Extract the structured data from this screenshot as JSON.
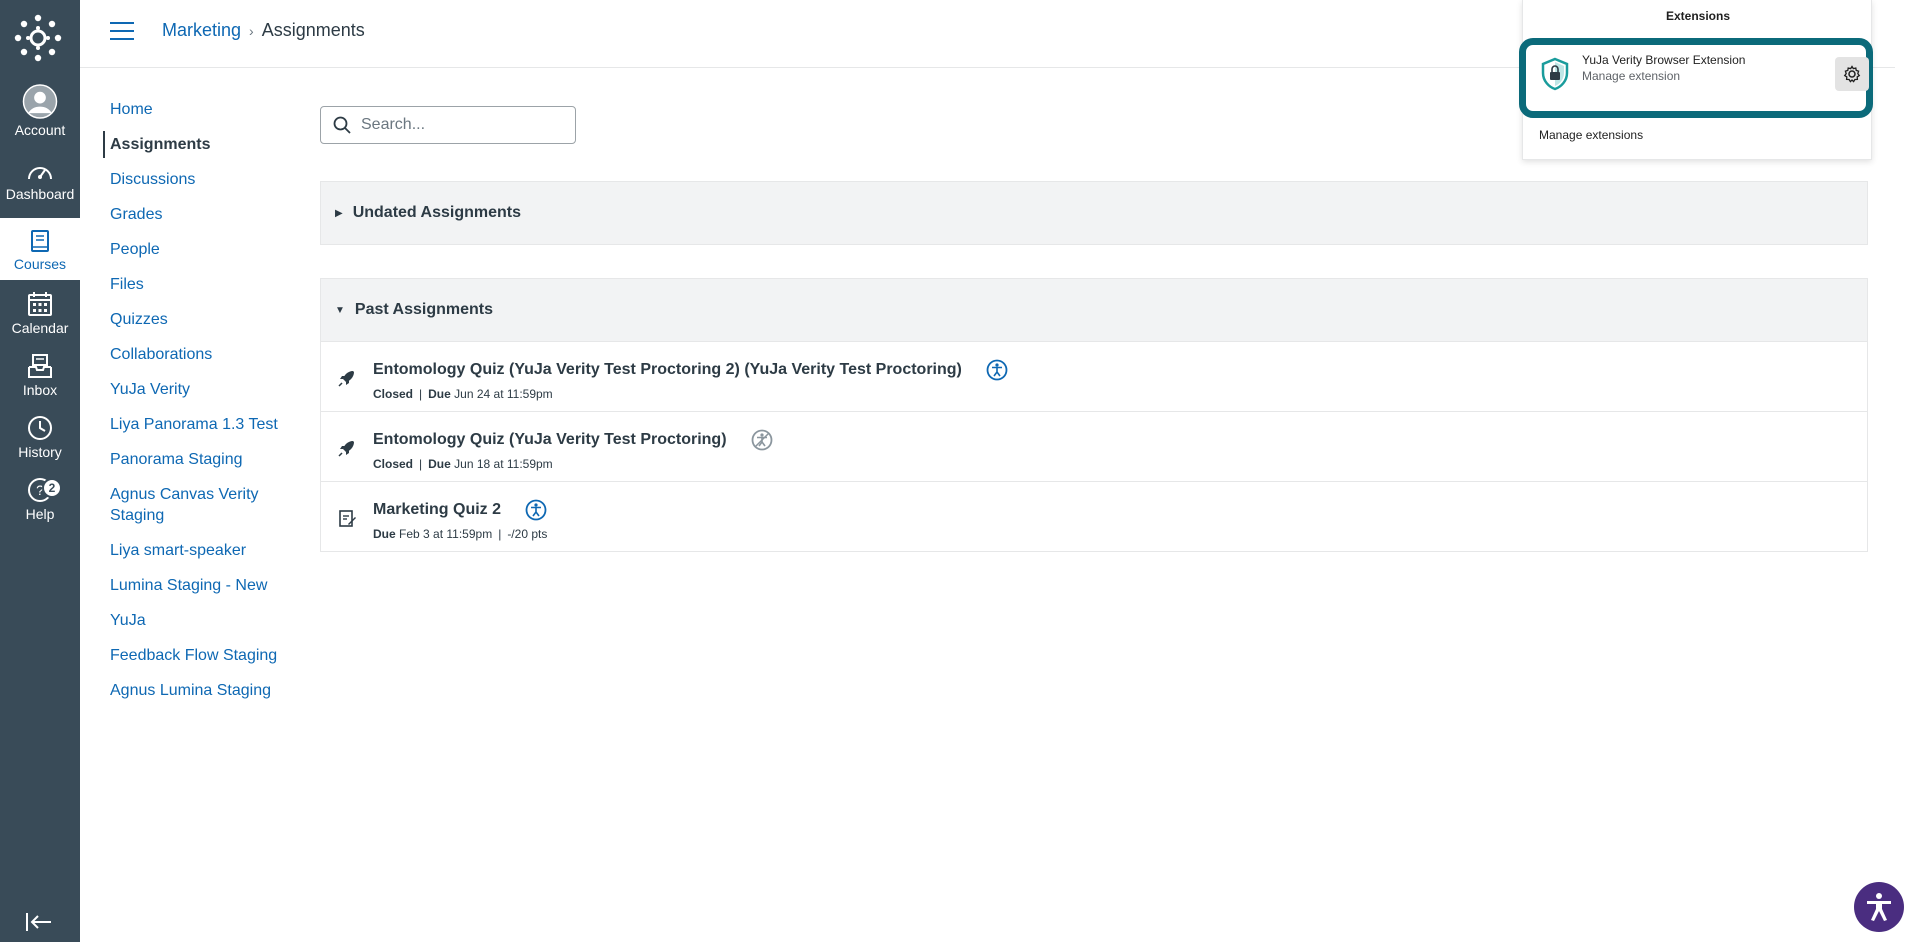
{
  "global_nav": {
    "items": [
      {
        "label": "Account",
        "icon": "account-icon"
      },
      {
        "label": "Dashboard",
        "icon": "dashboard-icon"
      },
      {
        "label": "Courses",
        "icon": "courses-icon"
      },
      {
        "label": "Calendar",
        "icon": "calendar-icon"
      },
      {
        "label": "Inbox",
        "icon": "inbox-icon"
      },
      {
        "label": "History",
        "icon": "history-icon"
      },
      {
        "label": "Help",
        "icon": "help-icon",
        "badge": "2"
      }
    ]
  },
  "breadcrumb": {
    "course": "Marketing",
    "current": "Assignments"
  },
  "course_nav": {
    "items": [
      "Home",
      "Assignments",
      "Discussions",
      "Grades",
      "People",
      "Files",
      "Quizzes",
      "Collaborations",
      "YuJa Verity",
      "Liya Panorama 1.3 Test",
      "Panorama Staging",
      "Agnus Canvas Verity Staging",
      "Liya smart-speaker",
      "Lumina Staging - New",
      "YuJa",
      "Feedback Flow Staging",
      "Agnus Lumina Staging"
    ],
    "active": "Assignments"
  },
  "search": {
    "placeholder": "Search..."
  },
  "groups": {
    "undated": {
      "title": "Undated Assignments"
    },
    "past": {
      "title": "Past Assignments",
      "rows": [
        {
          "title": "Entomology Quiz (YuJa Verity Test Proctoring 2) (YuJa Verity Test Proctoring)",
          "status": "Closed",
          "due_label": "Due",
          "due": "Jun 24 at 11:59pm",
          "pts": ""
        },
        {
          "title": "Entomology Quiz (YuJa Verity Test Proctoring)",
          "status": "Closed",
          "due_label": "Due",
          "due": "Jun 18 at 11:59pm",
          "pts": ""
        },
        {
          "title": "Marketing Quiz 2",
          "status": "",
          "due_label": "Due",
          "due": "Feb 3 at 11:59pm",
          "pts": "-/20 pts"
        }
      ]
    }
  },
  "extensions_popup": {
    "title": "Extensions",
    "extension_name": "YuJa Verity Browser Extension",
    "extension_sub": "Manage extension",
    "manage_link": "Manage extensions"
  },
  "colors": {
    "nav_bg": "#394b58",
    "link": "#0e68b3",
    "highlight": "#0b6a7a",
    "a11y_float": "#4a2d80"
  }
}
